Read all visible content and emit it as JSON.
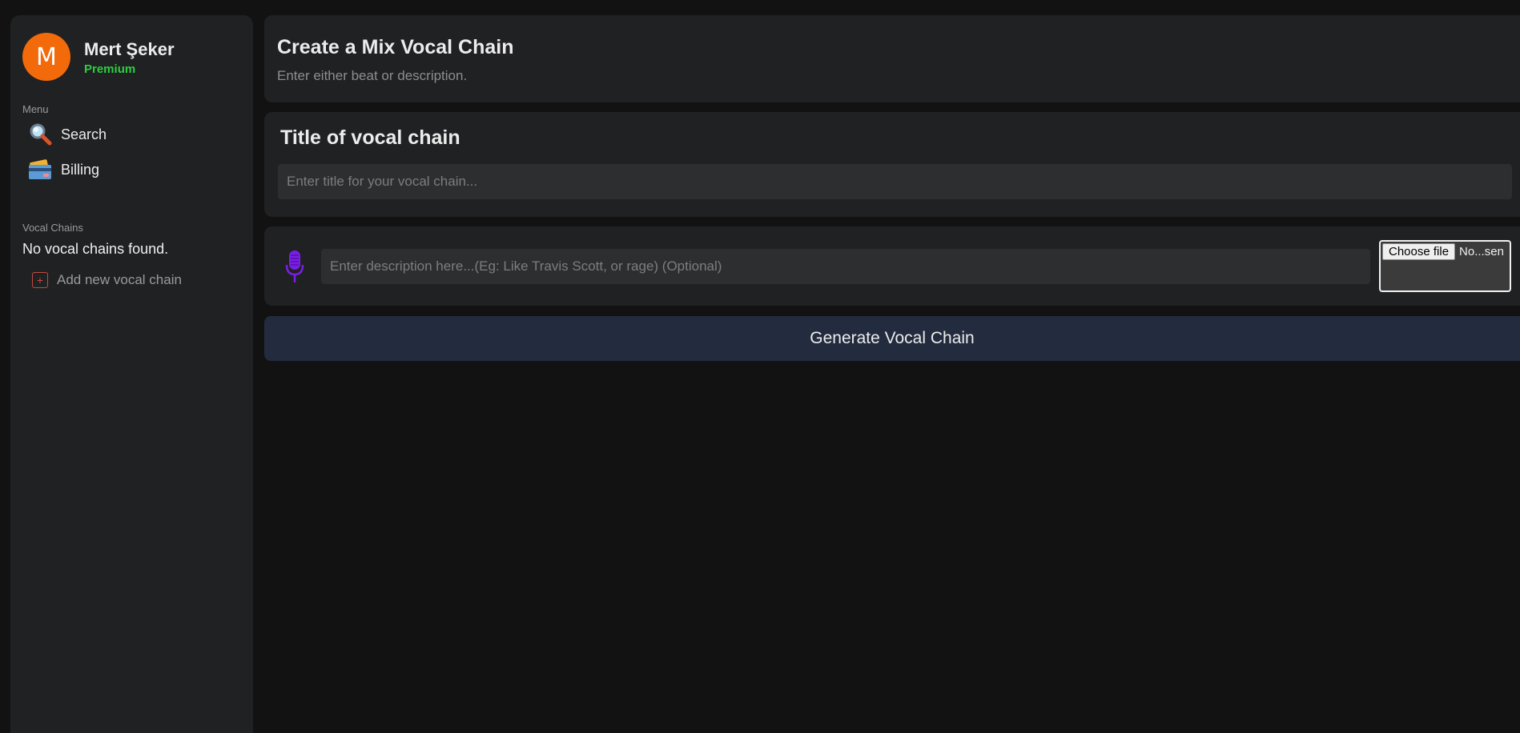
{
  "user": {
    "avatar_initial": "M",
    "name": "Mert Şeker",
    "plan": "Premium"
  },
  "sidebar": {
    "menu_label": "Menu",
    "items": [
      {
        "label": "Search",
        "icon": "magnifying-glass-icon"
      },
      {
        "label": "Billing",
        "icon": "credit-card-icon"
      }
    ],
    "vocal_chains_label": "Vocal Chains",
    "empty_message": "No vocal chains found.",
    "add_label": "Add new vocal chain"
  },
  "header": {
    "title": "Create a Mix Vocal Chain",
    "subtitle": "Enter either beat or description."
  },
  "title_section": {
    "heading": "Title of vocal chain",
    "placeholder": "Enter title for your vocal chain...",
    "value": ""
  },
  "description_section": {
    "icon": "microphone-icon",
    "placeholder": "Enter description here...(Eg: Like Travis Scott, or rage) (Optional)",
    "value": "",
    "file_button_label": "Choose file",
    "file_status": "No...sen"
  },
  "actions": {
    "generate_label": "Generate Vocal Chain"
  },
  "colors": {
    "background": "#121212",
    "panel": "#202123",
    "avatar": "#f36a0a",
    "premium": "#2ecc40",
    "mic": "#7a1ee6",
    "generate_button": "#232c3f"
  }
}
